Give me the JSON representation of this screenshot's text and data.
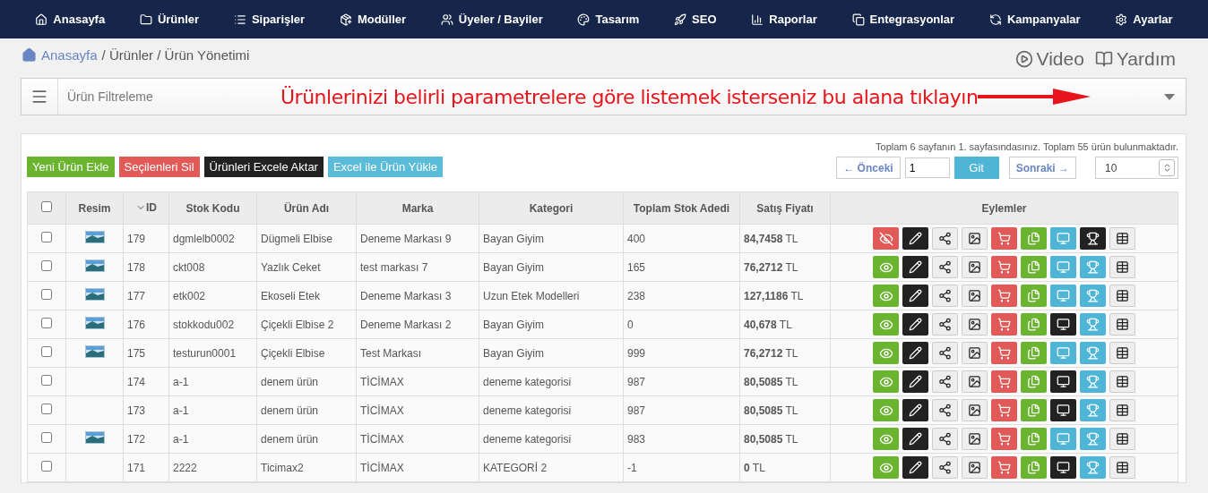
{
  "nav": [
    "Anasayfa",
    "Ürünler",
    "Siparişler",
    "Modüller",
    "Üyeler / Bayiler",
    "Tasarım",
    "SEO",
    "Raporlar",
    "Entegrasyonlar",
    "Kampanyalar",
    "Ayarlar"
  ],
  "breadcrumb": {
    "home": "Anasayfa",
    "rest": "/ Ürünler / Ürün Yönetimi"
  },
  "help_links": [
    "Video",
    "Yardım"
  ],
  "filter": {
    "label": "Ürün Filtreleme",
    "hint": "Ürünlerinizi belirli parametrelere göre listemek isterseniz bu alana tıklayın",
    "expanded": false
  },
  "actions": [
    {
      "label": "Yeni Ürün Ekle",
      "kind": "success"
    },
    {
      "label": "Seçilenleri Sil",
      "kind": "danger"
    },
    {
      "label": "Ürünleri Excele Aktar",
      "kind": "dark"
    },
    {
      "label": "Excel ile Ürün Yükle",
      "kind": "info"
    }
  ],
  "pagination": {
    "summary": "Toplam 6 sayfanın 1. sayfasındasınız. Toplam 55 ürün bulunmaktadır.",
    "prev": "← Önceki",
    "page": "1",
    "go": "Git",
    "next": "Sonraki →",
    "page_size": "10"
  },
  "table": {
    "all_checked": false,
    "columns": [
      {
        "label": "Resim",
        "sorted": false
      },
      {
        "label": "ID",
        "sorted": true
      },
      {
        "label": "Stok Kodu",
        "sorted": false
      },
      {
        "label": "Ürün Adı",
        "sorted": false
      },
      {
        "label": "Marka",
        "sorted": false
      },
      {
        "label": "Kategori",
        "sorted": false
      },
      {
        "label": "Toplam Stok Adedi",
        "sorted": false
      },
      {
        "label": "Satış Fiyatı",
        "sorted": false
      },
      {
        "label": "Eylemler",
        "sorted": false
      }
    ],
    "rows": [
      {
        "checked": false,
        "has_image": true,
        "id": "179",
        "sku": "dgmlelb0002",
        "name": "Dügmeli Elbise",
        "brand": "Deneme Markası 9",
        "category": "Bayan Giyim",
        "stock": "400",
        "price": "**84,7458** TL",
        "visible": false,
        "showcase": true,
        "featured": false
      },
      {
        "checked": false,
        "has_image": true,
        "id": "178",
        "sku": "ckt008",
        "name": "Yazlık Ceket",
        "brand": "test markası 7",
        "category": "Bayan Giyim",
        "stock": "165",
        "price": "**76,2712** TL",
        "visible": true,
        "showcase": true,
        "featured": true
      },
      {
        "checked": false,
        "has_image": true,
        "id": "177",
        "sku": "etk002",
        "name": "Ekoseli Etek",
        "brand": "Deneme Markası 3",
        "category": "Uzun Etek Modelleri",
        "stock": "238",
        "price": "**127,1186** TL",
        "visible": true,
        "showcase": true,
        "featured": true
      },
      {
        "checked": false,
        "has_image": true,
        "id": "176",
        "sku": "stokkodu002",
        "name": "Çiçekli Elbise 2",
        "brand": "Deneme Markası 2",
        "category": "Bayan Giyim",
        "stock": "0",
        "price": "**40,678** TL",
        "visible": true,
        "showcase": false,
        "featured": true
      },
      {
        "checked": false,
        "has_image": true,
        "id": "175",
        "sku": "testurun0001",
        "name": "Çiçekli Elbise",
        "brand": "Test Markası",
        "category": "Bayan Giyim",
        "stock": "999",
        "price": "**76,2712** TL",
        "visible": true,
        "showcase": true,
        "featured": true
      },
      {
        "checked": false,
        "has_image": false,
        "id": "174",
        "sku": "a-1",
        "name": "denem ürün",
        "brand": "TİCİMAX",
        "category": "deneme kategorisi",
        "stock": "987",
        "price": "**80,5085** TL",
        "visible": true,
        "showcase": false,
        "featured": true
      },
      {
        "checked": false,
        "has_image": false,
        "id": "173",
        "sku": "a-1",
        "name": "denem ürün",
        "brand": "TİCİMAX",
        "category": "deneme kategorisi",
        "stock": "987",
        "price": "**80,5085** TL",
        "visible": true,
        "showcase": false,
        "featured": true
      },
      {
        "checked": false,
        "has_image": true,
        "id": "172",
        "sku": "a-1",
        "name": "denem ürün",
        "brand": "TİCİMAX",
        "category": "deneme kategorisi",
        "stock": "983",
        "price": "**80,5085** TL",
        "visible": true,
        "showcase": true,
        "featured": true
      },
      {
        "checked": false,
        "has_image": false,
        "id": "171",
        "sku": "2222",
        "name": "Ticimax2",
        "brand": "TİCİMAX",
        "category": "KATEGORİ 2",
        "stock": "-1",
        "price": "**0** TL",
        "visible": true,
        "showcase": false,
        "featured": true
      }
    ]
  }
}
